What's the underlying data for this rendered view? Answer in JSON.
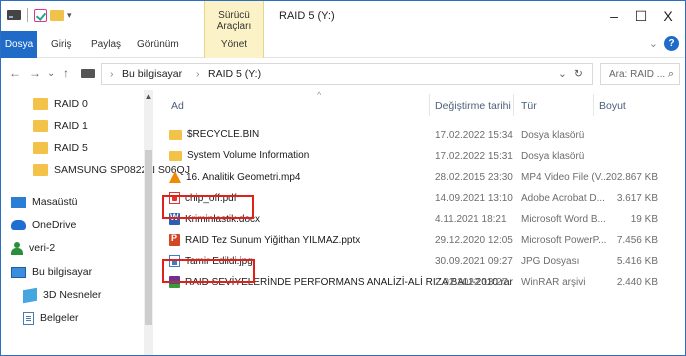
{
  "titlebar": {
    "context_tab_group": "Sürücü Araçları",
    "window_title": "RAID 5 (Y:)",
    "minimize": "–",
    "maximize": "☐",
    "close": "X"
  },
  "ribbon": {
    "tabs": [
      "Dosya",
      "Giriş",
      "Paylaş",
      "Görünüm",
      "Yönet"
    ],
    "expand": "⌄",
    "help": "?"
  },
  "address": {
    "back": "←",
    "forward": "→",
    "recent": "⌄",
    "up": "↑",
    "crumbs": [
      "Bu bilgisayar",
      "RAID 5 (Y:)"
    ],
    "crumb_sep": "›",
    "dropdown": "⌄",
    "refresh": "↻",
    "search_placeholder": "Ara: RAID ...",
    "search_icon": "⌕"
  },
  "nav": {
    "items": [
      {
        "label": "RAID 0",
        "icon": "folder-icon"
      },
      {
        "label": "RAID 1",
        "icon": "folder-icon"
      },
      {
        "label": "RAID 5",
        "icon": "folder-icon"
      },
      {
        "label": "SAMSUNG SP0822N S06QJ",
        "icon": "folder-icon"
      },
      {
        "label": "Masaüstü",
        "icon": "desktop-icon"
      },
      {
        "label": "OneDrive",
        "icon": "cloud-icon"
      },
      {
        "label": "veri-2",
        "icon": "user-icon"
      },
      {
        "label": "Bu bilgisayar",
        "icon": "computer-icon"
      },
      {
        "label": "3D Nesneler",
        "icon": "3d-objects-icon"
      },
      {
        "label": "Belgeler",
        "icon": "documents-icon"
      }
    ],
    "scroll_up": "▲"
  },
  "columns": {
    "name": "Ad",
    "modified": "Değiştirme tarihi",
    "type": "Tür",
    "size": "Boyut",
    "sort_indicator": "^"
  },
  "files": [
    {
      "name": "$RECYCLE.BIN",
      "modified": "17.02.2022 15:34",
      "type": "Dosya klasörü",
      "size": "",
      "icon": "folder",
      "icon_name": "folder-icon"
    },
    {
      "name": "System Volume Information",
      "modified": "17.02.2022 15:31",
      "type": "Dosya klasörü",
      "size": "",
      "icon": "folder",
      "icon_name": "folder-icon"
    },
    {
      "name": "16. Analitik Geometri.mp4",
      "modified": "28.02.2015 23:30",
      "type": "MP4 Video File (V...",
      "size": "202.867 KB",
      "icon": "vlc",
      "icon_name": "video-file-icon"
    },
    {
      "name": "chip_off.pdf",
      "modified": "14.09.2021 13:10",
      "type": "Adobe Acrobat D...",
      "size": "3.617 KB",
      "icon": "pdf",
      "icon_name": "pdf-file-icon"
    },
    {
      "name": "Kriminlastik.docx",
      "modified": "4.11.2021 18:21",
      "type": "Microsoft Word B...",
      "size": "19 KB",
      "icon": "docx",
      "icon_name": "word-file-icon"
    },
    {
      "name": "RAID Tez Sunum Yiğithan YILMAZ.pptx",
      "modified": "29.12.2020 12:05",
      "type": "Microsoft PowerP...",
      "size": "7.456 KB",
      "icon": "pptx",
      "icon_name": "powerpoint-file-icon"
    },
    {
      "name": "Tamir Edildi.jpg",
      "modified": "30.09.2021 09:27",
      "type": "JPG Dosyası",
      "size": "5.416 KB",
      "icon": "jpg",
      "icon_name": "image-file-icon"
    },
    {
      "name": "RAID SEVİYELERİNDE PERFORMANS ANALİZİ-ALİ RIZA BALI-2010.rar",
      "modified": "2.02.2022 13:27",
      "type": "WinRAR arşivi",
      "size": "2.440 KB",
      "icon": "rar",
      "icon_name": "rar-archive-icon"
    }
  ],
  "colors": {
    "accent": "#1f6bc7",
    "context_tab": "#fbf2c8",
    "highlight_box": "#e0201a"
  }
}
